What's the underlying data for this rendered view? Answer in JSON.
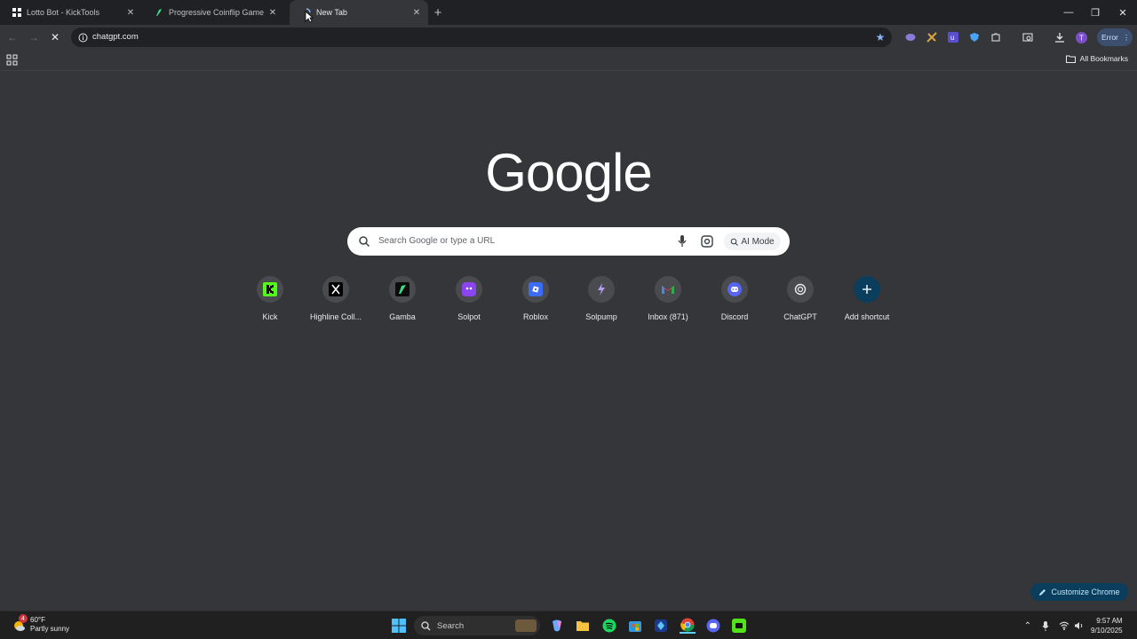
{
  "browser": {
    "tabs": [
      {
        "title": "Lotto Bot - KickTools",
        "icon": "grid-icon",
        "active": false
      },
      {
        "title": "Progressive Coinflip Game Onli",
        "icon": "gamba-icon",
        "active": false
      },
      {
        "title": "New Tab",
        "icon": "loading-icon",
        "active": true
      }
    ],
    "address": "chatgpt.com",
    "error_label": "Error",
    "all_bookmarks": "All Bookmarks"
  },
  "newtab": {
    "logo": "Google",
    "search_placeholder": "Search Google or type a URL",
    "ai_mode": "AI Mode",
    "shortcuts": [
      {
        "label": "Kick",
        "icon": "kick-icon"
      },
      {
        "label": "Highline Coll...",
        "icon": "x-icon"
      },
      {
        "label": "Gamba",
        "icon": "gamba-icon"
      },
      {
        "label": "Solpot",
        "icon": "solpot-icon"
      },
      {
        "label": "Roblox",
        "icon": "roblox-icon"
      },
      {
        "label": "Solpump",
        "icon": "solpump-icon"
      },
      {
        "label": "Inbox (871)",
        "icon": "gmail-icon"
      },
      {
        "label": "Discord",
        "icon": "discord-icon"
      },
      {
        "label": "ChatGPT",
        "icon": "chatgpt-icon"
      },
      {
        "label": "Add shortcut",
        "icon": "plus-icon"
      }
    ],
    "customize": "Customize Chrome"
  },
  "taskbar": {
    "weather_temp": "60°F",
    "weather_desc": "Partly sunny",
    "weather_badge": "4",
    "search_label": "Search",
    "time": "9:57 AM",
    "date": "9/10/2025",
    "accent": "#53e31a"
  }
}
